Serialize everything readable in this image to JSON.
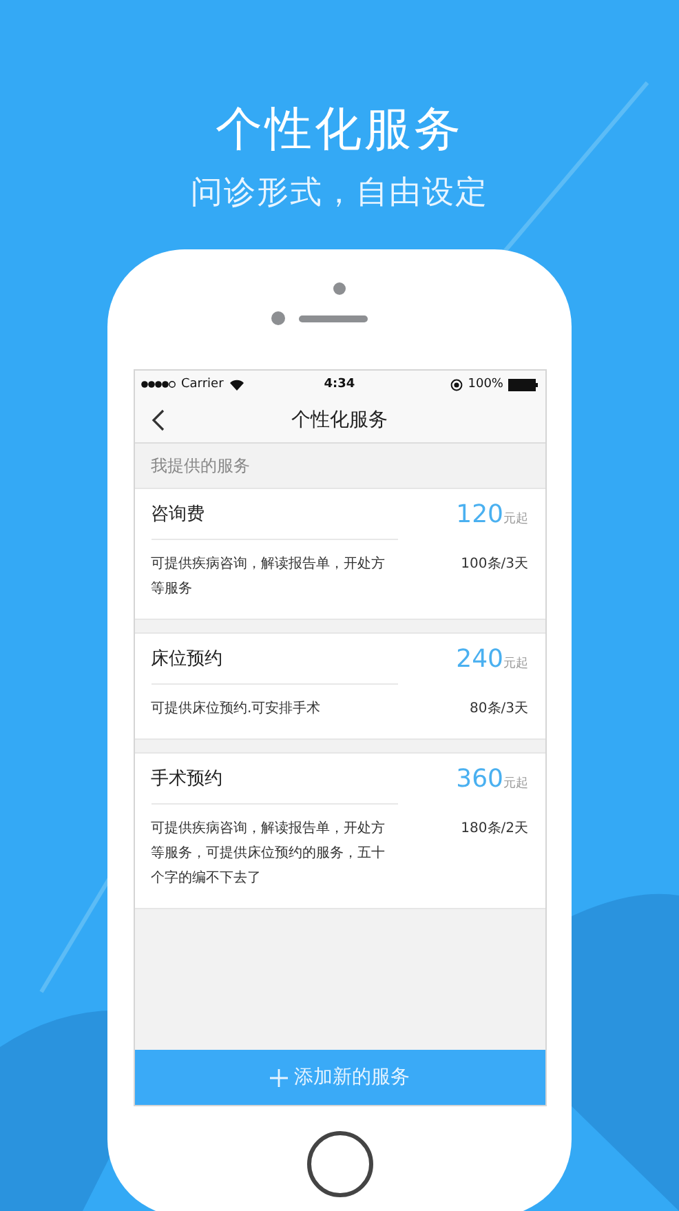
{
  "header": {
    "title": "个性化服务",
    "subtitle": "问诊形式，自由设定"
  },
  "status_bar": {
    "carrier": "Carrier",
    "time": "4:34",
    "battery": "100%"
  },
  "nav": {
    "title": "个性化服务"
  },
  "section_label": "我提供的服务",
  "services": [
    {
      "name": "咨询费",
      "price": "120",
      "price_suffix": "元起",
      "description": "可提供疾病咨询，解读报告单，开处方等服务",
      "quota": "100条/3天"
    },
    {
      "name": "床位预约",
      "price": "240",
      "price_suffix": "元起",
      "description": "可提供床位预约.可安排手术",
      "quota": "80条/3天"
    },
    {
      "name": "手术预约",
      "price": "360",
      "price_suffix": "元起",
      "description": "可提供疾病咨询，解读报告单，开处方等服务，可提供床位预约的服务，五十个字的编不下去了",
      "quota": "180条/2天"
    }
  ],
  "add_button": {
    "label": "添加新的服务"
  }
}
